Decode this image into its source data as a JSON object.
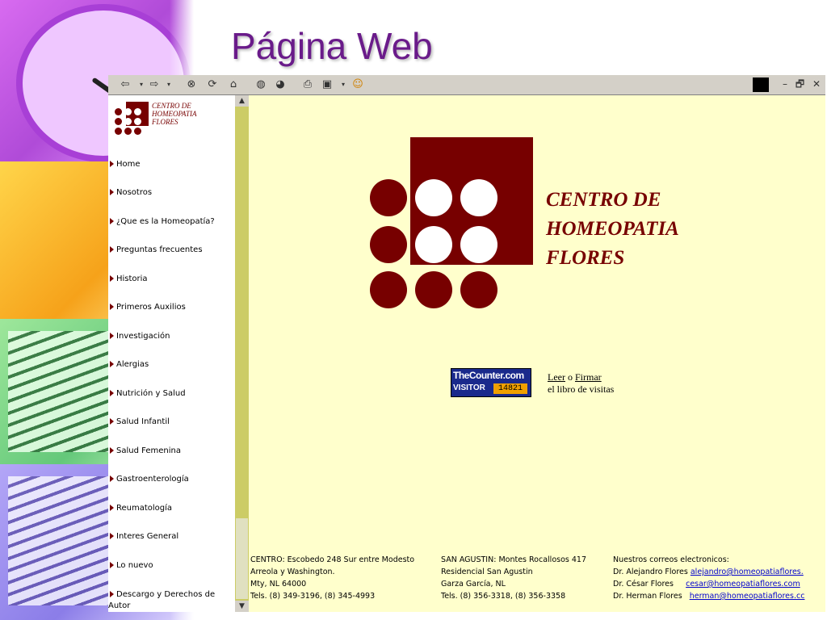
{
  "slide": {
    "title": "Página Web"
  },
  "browser": {
    "toolbar_icons": [
      "back-icon",
      "forward-icon",
      "stop-icon",
      "refresh-icon",
      "home-icon",
      "search-icon",
      "history-icon",
      "print-icon",
      "edit-icon",
      "messenger-icon"
    ],
    "window_controls": [
      "–",
      "🗗",
      "✕"
    ]
  },
  "site": {
    "logo_small": [
      "CENTRO DE",
      "HOMEOPATIA",
      "FLORES"
    ],
    "nav": [
      "Home",
      "Nosotros",
      "¿Que es la Homeopatía?",
      "Preguntas frecuentes",
      "Historia",
      "Primeros Auxilios",
      "Investigación",
      "Alergias",
      "Nutrición y Salud",
      "Salud Infantil",
      "Salud Femenina",
      "Gastroenterología",
      "Reumatología",
      "Interes General",
      "Lo nuevo",
      "Descargo y Derechos de",
      "Autor"
    ],
    "logo_big": [
      "CENTRO DE",
      "HOMEOPATIA",
      "FLORES"
    ],
    "counter": {
      "brand": "TheCounter.com",
      "label": "VISITOR",
      "count": "14821"
    },
    "guestbook": {
      "read": "Leer",
      "or": "o",
      "sign": "Firmar",
      "suffix": "el libro de visitas"
    },
    "footer": {
      "centro": [
        "CENTRO: Escobedo 248 Sur entre Modesto",
        "Arreola y Washington.",
        "Mty, NL 64000",
        "Tels. (8) 349-3196, (8) 345-4993"
      ],
      "san_agustin": [
        "SAN AGUSTIN: Montes Rocallosos 417",
        "Residencial San Agustin",
        "Garza García, NL",
        "Tels. (8) 356-3318, (8) 356-3358"
      ],
      "emails_title": "Nuestros correos electronicos:",
      "emails": [
        {
          "name": "Dr. Alejandro Flores",
          "email": "alejandro@homeopatiaflores."
        },
        {
          "name": "Dr. César Flores",
          "email": "cesar@homeopatiaflores.com"
        },
        {
          "name": "Dr. Herman Flores",
          "email": "herman@homeopatiaflores.cc"
        }
      ]
    }
  }
}
